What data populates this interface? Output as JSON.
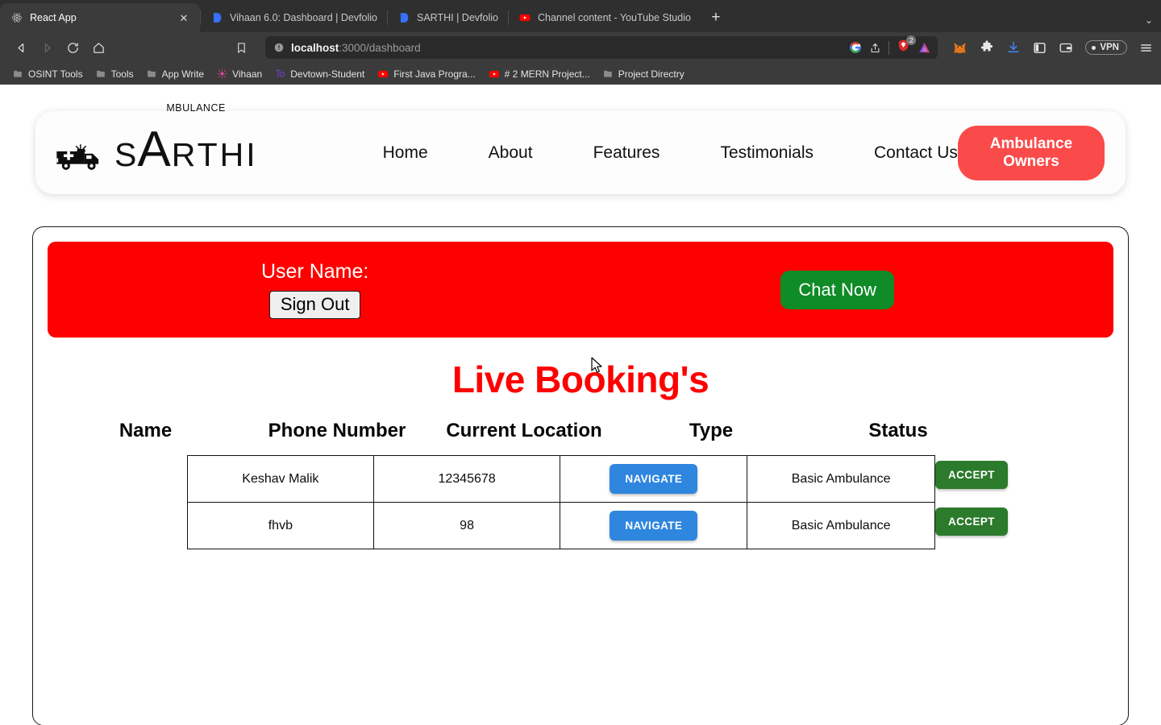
{
  "browser": {
    "tabs": [
      {
        "title": "React App",
        "icon": "react-icon",
        "active": true
      },
      {
        "title": "Vihaan 6.0: Dashboard | Devfolio",
        "icon": "devfolio-icon",
        "active": false
      },
      {
        "title": "SARTHI | Devfolio",
        "icon": "devfolio-icon",
        "active": false
      },
      {
        "title": "Channel content - YouTube Studio",
        "icon": "youtube-icon",
        "active": false
      }
    ],
    "new_tab_label": "+",
    "tab_list_chevron": "⌄",
    "nav": {
      "back": "back-arrow-icon",
      "forward": "forward-arrow-icon",
      "reload": "reload-icon",
      "home": "home-icon",
      "bookmark": "bookmark-icon"
    },
    "url": {
      "host": "localhost",
      "path": ":3000/dashboard",
      "security_icon": "not-secure-info-icon"
    },
    "url_icons": [
      "google-lens-icon",
      "share-icon",
      "brave-shields-icon",
      "brave-rewards-icon"
    ],
    "shield_badge": "2",
    "toolbar_icons": [
      "metamask-fox-icon",
      "extensions-puzzle-icon",
      "downloads-icon",
      "sidebar-toggle-icon",
      "brave-wallet-icon"
    ],
    "vpn_label": "VPN",
    "menu_icon": "hamburger-menu-icon",
    "bookmarks": [
      {
        "label": "OSINT Tools",
        "icon": "folder-icon"
      },
      {
        "label": "Tools",
        "icon": "folder-icon"
      },
      {
        "label": "App Write",
        "icon": "folder-icon"
      },
      {
        "label": "Vihaan",
        "icon": "vihaan-icon"
      },
      {
        "label": "Devtown-Student",
        "icon": "devtown-icon"
      },
      {
        "label": "First Java Progra...",
        "icon": "youtube-icon"
      },
      {
        "label": "# 2 MERN Project...",
        "icon": "youtube-icon"
      },
      {
        "label": "Project Directry",
        "icon": "folder-icon"
      }
    ]
  },
  "site_header": {
    "logo": {
      "icon": "ambulance-icon",
      "s": "S",
      "a": "A",
      "superscript": "MBULANCE",
      "rest": "RTHI"
    },
    "nav_links": [
      "Home",
      "About",
      "Features",
      "Testimonials",
      "Contact Us"
    ],
    "owners_button": "Ambulance Owners"
  },
  "dashboard": {
    "user_banner": {
      "user_name_label": "User Name:",
      "sign_out_button": "Sign Out",
      "chat_button": "Chat Now",
      "background_color": "#fe0000"
    },
    "title": "Live Booking's",
    "title_color": "#fe0000",
    "table": {
      "headers": [
        "Name",
        "Phone Number",
        "Current Location",
        "Type",
        "Status"
      ],
      "rows": [
        {
          "name": "Keshav Malik",
          "phone": "12345678",
          "location_button": "NAVIGATE",
          "type": "Basic Ambulance",
          "status_button": "ACCEPT"
        },
        {
          "name": "fhvb",
          "phone": "98",
          "location_button": "NAVIGATE",
          "type": "Basic Ambulance",
          "status_button": "ACCEPT"
        }
      ],
      "navigate_color": "#2e86de",
      "accept_color": "#2c7a2c"
    }
  }
}
